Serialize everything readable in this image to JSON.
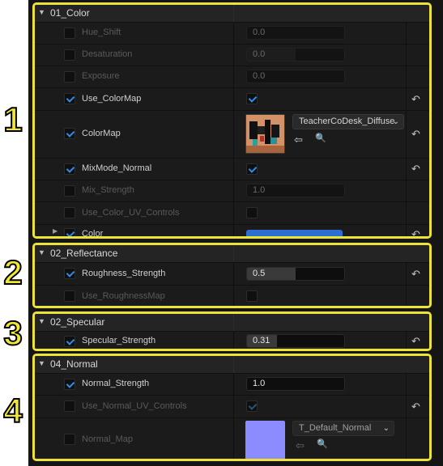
{
  "markers": [
    "1",
    "2",
    "3",
    "4"
  ],
  "icons": {
    "collapse": "▼",
    "expand": "▶",
    "reset": "↶",
    "chevron": "⌄",
    "use_asset": "⇦",
    "browse": "🔍"
  },
  "colors": {
    "frame": "#ece23a",
    "checkbox_accent": "#2e8ee8",
    "color_value": "#2d6fd1",
    "normal_map_thumb": "#8c8cff"
  },
  "sections": {
    "color": {
      "title": "01_Color",
      "params": {
        "hue_shift": {
          "name": "Hue_Shift",
          "value": "0.0",
          "enabled": false
        },
        "desaturation": {
          "name": "Desaturation",
          "value": "0.0",
          "enabled": false
        },
        "exposure": {
          "name": "Exposure",
          "value": "0.0",
          "enabled": false
        },
        "use_colormap": {
          "name": "Use_ColorMap",
          "enabled": true,
          "checked": true
        },
        "colormap": {
          "name": "ColorMap",
          "enabled": true,
          "asset": "TeacherCoDesk_Diffuse"
        },
        "mixmode_normal": {
          "name": "MixMode_Normal",
          "enabled": true,
          "checked": true
        },
        "mix_strength": {
          "name": "Mix_Strength",
          "value": "1.0",
          "enabled": false
        },
        "use_color_uv": {
          "name": "Use_Color_UV_Controls",
          "enabled": false,
          "checked": false
        },
        "color": {
          "name": "Color",
          "enabled": true
        }
      }
    },
    "reflectance": {
      "title": "02_Reflectance",
      "params": {
        "roughness_strength": {
          "name": "Roughness_Strength",
          "value": "0.5",
          "fraction": 0.5,
          "enabled": true
        },
        "use_roughnessmap": {
          "name": "Use_RoughnessMap",
          "enabled": false,
          "checked": false
        }
      }
    },
    "specular": {
      "title": "02_Specular",
      "params": {
        "specular_strength": {
          "name": "Specular_Strength",
          "value": "0.31",
          "fraction": 0.31,
          "enabled": true
        }
      }
    },
    "normal": {
      "title": "04_Normal",
      "params": {
        "normal_strength": {
          "name": "Normal_Strength",
          "value": "1.0",
          "enabled": true
        },
        "use_normal_uv": {
          "name": "Use_Normal_UV_Controls",
          "enabled": false,
          "checked": true
        },
        "normal_map": {
          "name": "Normal_Map",
          "enabled": false,
          "asset": "T_Default_Normal"
        }
      }
    }
  }
}
